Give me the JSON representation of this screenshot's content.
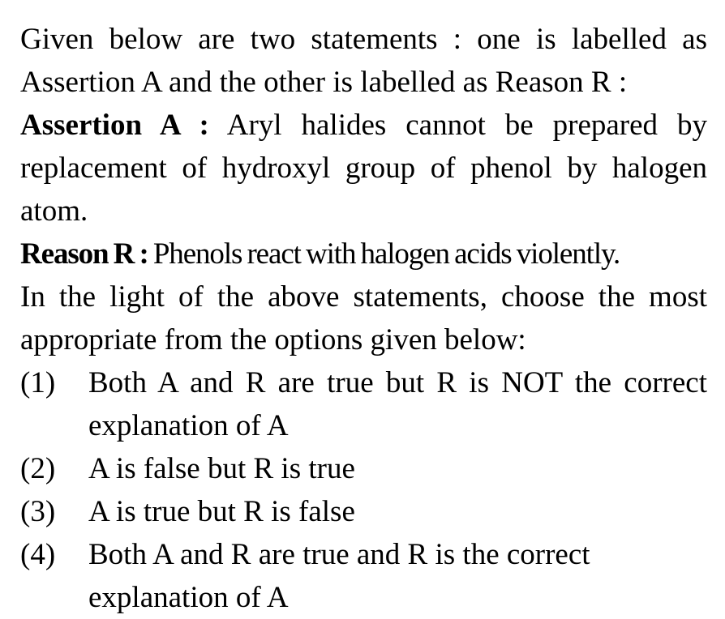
{
  "question": {
    "intro": "Given below are two statements : one is labelled as Assertion A and the other is labelled as Reason R :",
    "assertion_label": "Assertion A :",
    "assertion_text": "Aryl halides cannot be prepared by replacement of hydroxyl group of phenol by halogen atom.",
    "reason_label": "Reason R :",
    "reason_text": "Phenols react with halogen acids violently.",
    "instruction": "In the light of the above statements, choose the most appropriate from the options given below:"
  },
  "options": [
    {
      "number": "(1)",
      "text": "Both A and R are true but R is NOT the correct explanation of A"
    },
    {
      "number": "(2)",
      "text": "A is false but R is true"
    },
    {
      "number": "(3)",
      "text": "A is true but R is false"
    },
    {
      "number": "(4)",
      "text": "Both A and R are true and R is the correct explanation of A"
    }
  ]
}
